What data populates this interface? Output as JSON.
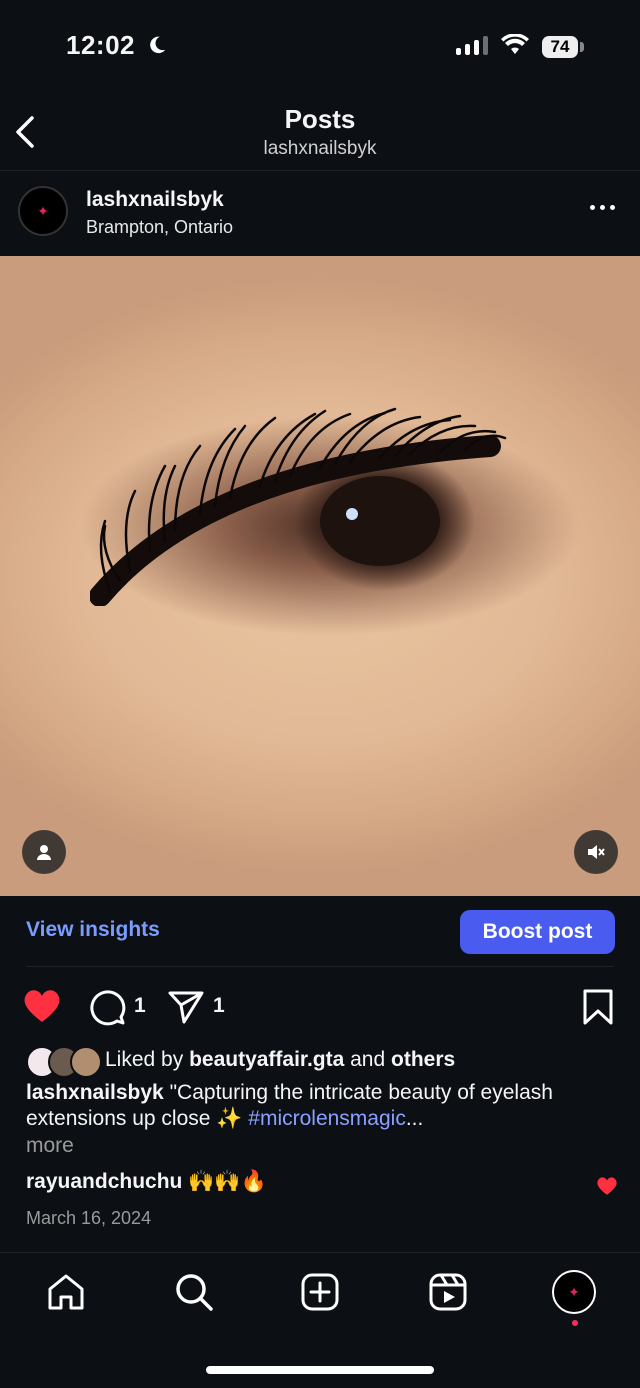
{
  "status_bar": {
    "time": "12:02",
    "battery": "74"
  },
  "header": {
    "title": "Posts",
    "subtitle": "lashxnailsbyk"
  },
  "post": {
    "username": "lashxnailsbyk",
    "location": "Brampton, Ontario",
    "view_insights": "View insights",
    "boost_post": "Boost post",
    "comment_count": "1",
    "share_count": "1",
    "liked_by_prefix": "Liked by ",
    "liked_by_user": "beautyaffair.gta",
    "liked_by_and": " and ",
    "liked_by_others": "others",
    "caption_user": "lashxnailsbyk",
    "caption_text": " \"Capturing the intricate beauty of eyelash extensions up close ✨ ",
    "caption_hashtag": "#microlensmagic",
    "caption_ellipsis": "...",
    "more": "more",
    "comment_user": "rayuandchuchu",
    "comment_text": " 🙌🙌🔥",
    "date": "March 16, 2024"
  },
  "icons": {
    "back": "chevron-left-icon",
    "more": "ellipsis-icon",
    "like": "heart-icon",
    "comment": "comment-icon",
    "share": "send-icon",
    "save": "bookmark-icon",
    "home": "home-icon",
    "search": "search-icon",
    "create": "plus-square-icon",
    "reels": "reels-icon"
  },
  "colors": {
    "background": "#0c0f14",
    "accent_link": "#7a9cff",
    "boost_button": "#4a5cf0",
    "like_red": "#ff3040"
  }
}
